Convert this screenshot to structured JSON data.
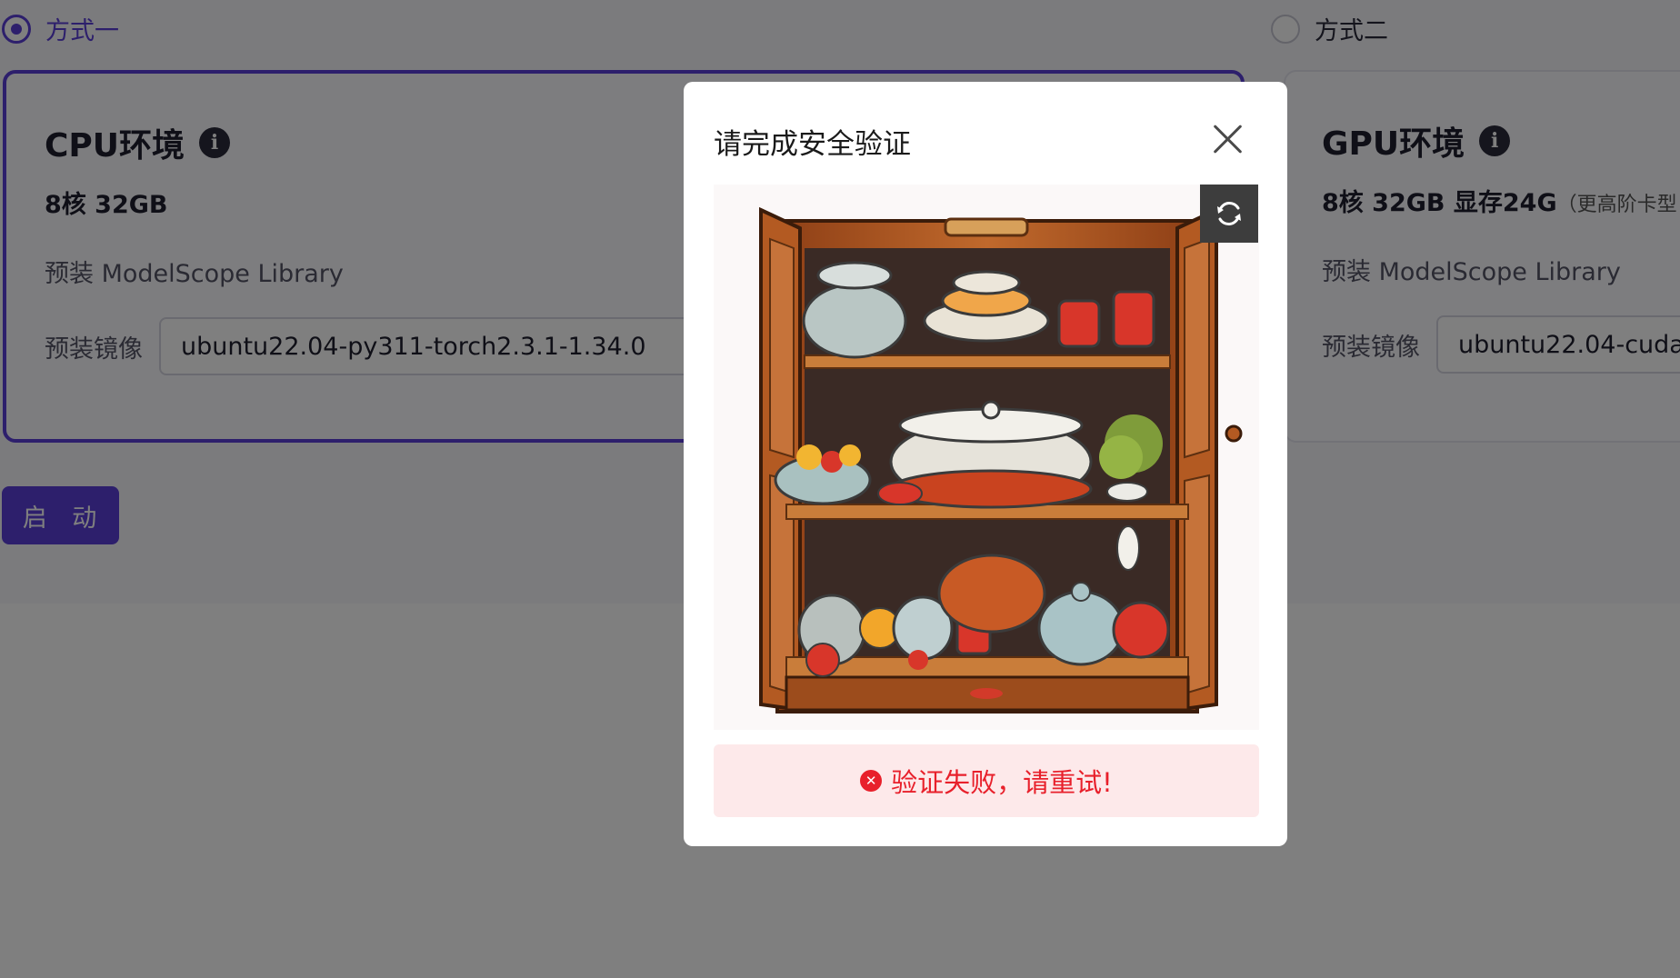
{
  "mode_selector": {
    "option_1": {
      "label": "方式一",
      "selected": true
    },
    "option_2": {
      "label": "方式二",
      "selected": false
    }
  },
  "cpu_env": {
    "title": "CPU环境",
    "spec": "8核 32GB",
    "library": "预装 ModelScope Library",
    "image_label": "预装镜像",
    "image_value": "ubuntu22.04-py311-torch2.3.1-1.34.0"
  },
  "gpu_env": {
    "title": "GPU环境",
    "spec": "8核 32GB 显存24G",
    "spec_note": "（更高阶卡型",
    "library": "预装 ModelScope Library",
    "image_label": "预装镜像",
    "image_value": "ubuntu22.04-cuda"
  },
  "start_button": {
    "label": "启 动"
  },
  "captcha_modal": {
    "title": "请完成安全验证",
    "error_message": "验证失败，请重试!",
    "close_icon": "close-icon",
    "refresh_icon": "refresh-icon"
  },
  "colors": {
    "accent": "#5b3fd8",
    "error": "#e8202b",
    "error_bg": "#fde9ea"
  }
}
